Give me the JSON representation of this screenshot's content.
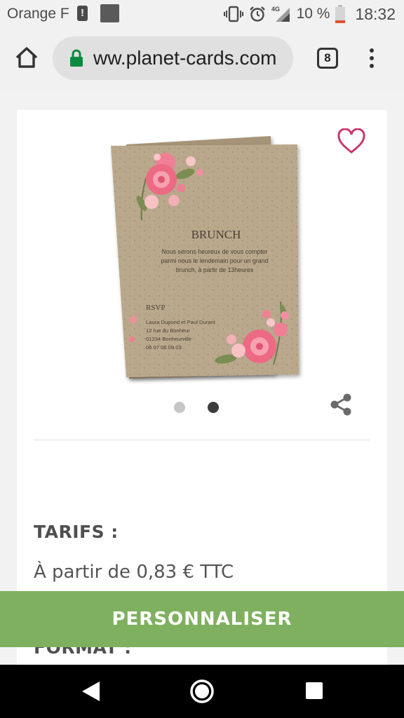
{
  "status_bar": {
    "carrier": "Orange F",
    "network": "4G",
    "battery": "10 %",
    "time": "18:32"
  },
  "browser": {
    "url": "ww.planet-cards.com",
    "tab_count": "8"
  },
  "product": {
    "card_title": "BRUNCH",
    "card_text_line1": "Nous serons heureux de vous compter",
    "card_text_line2": "parmi nous le lendemain pour un grand",
    "card_text_line3": "brunch, à partir de 13heures",
    "rsvp": "RSVP",
    "contact_line1": "Laura Dupond et Paul Durant",
    "contact_line2": "12 rue du Bonheur",
    "contact_line3": "01234 Bonheurville",
    "contact_line4": "06 07 08 09 03",
    "carousel_total": 2,
    "carousel_active": 2
  },
  "pricing": {
    "title": "TARIFS :",
    "price": "À partir de 0,83 € TTC"
  },
  "format": {
    "title": "FORMAT :"
  },
  "cta": {
    "label": "PERSONNALISER"
  },
  "colors": {
    "accent_green": "#7fb05f",
    "heart_pink": "#c8386b",
    "kraft": "#b7a68a"
  }
}
